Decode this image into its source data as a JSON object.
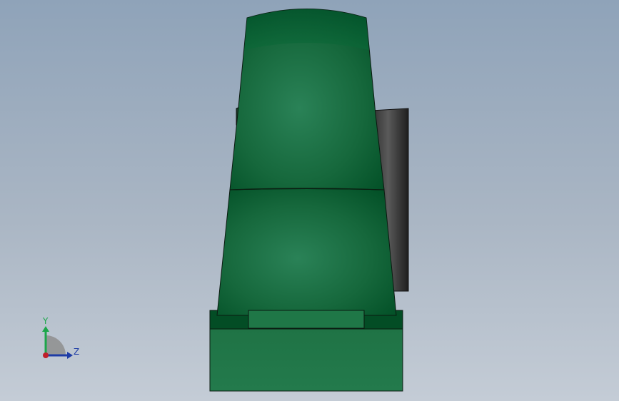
{
  "colors": {
    "part_green": "#237a4c",
    "part_green_dark": "#045a2c",
    "part_green_deep": "#00401f",
    "rear_plate_dark": "#3c3c3c",
    "axis_y": "#1ca64a",
    "axis_z": "#1e3ca6",
    "axis_x": "#c01f2a"
  },
  "triad": {
    "y_label": "Y",
    "z_label": "Z",
    "icons": [
      "axis-y-arrow-icon",
      "axis-z-arrow-icon",
      "origin-dot-icon"
    ]
  }
}
